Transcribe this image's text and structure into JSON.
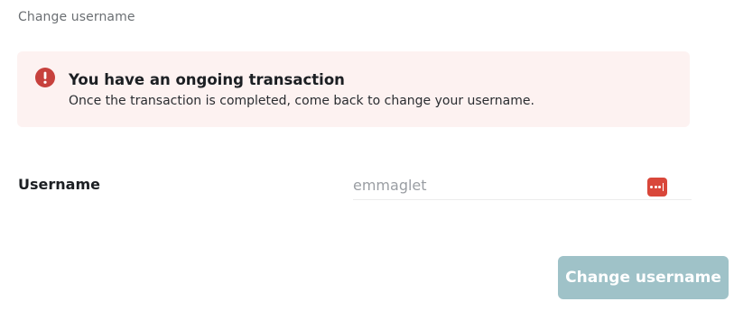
{
  "section": {
    "title": "Change username"
  },
  "alert": {
    "icon": "exclamation-circle-icon",
    "color": "#c7413d",
    "background": "#fdf2f1",
    "title": "You have an ongoing transaction",
    "message": "Once the transaction is completed, come back to change your username."
  },
  "form": {
    "username_label": "Username",
    "username_value": "emmaglet",
    "password_manager_icon": "password-manager-icon"
  },
  "actions": {
    "submit_label": "Change username",
    "submit_color": "#9fc2c8",
    "submit_enabled": false
  }
}
